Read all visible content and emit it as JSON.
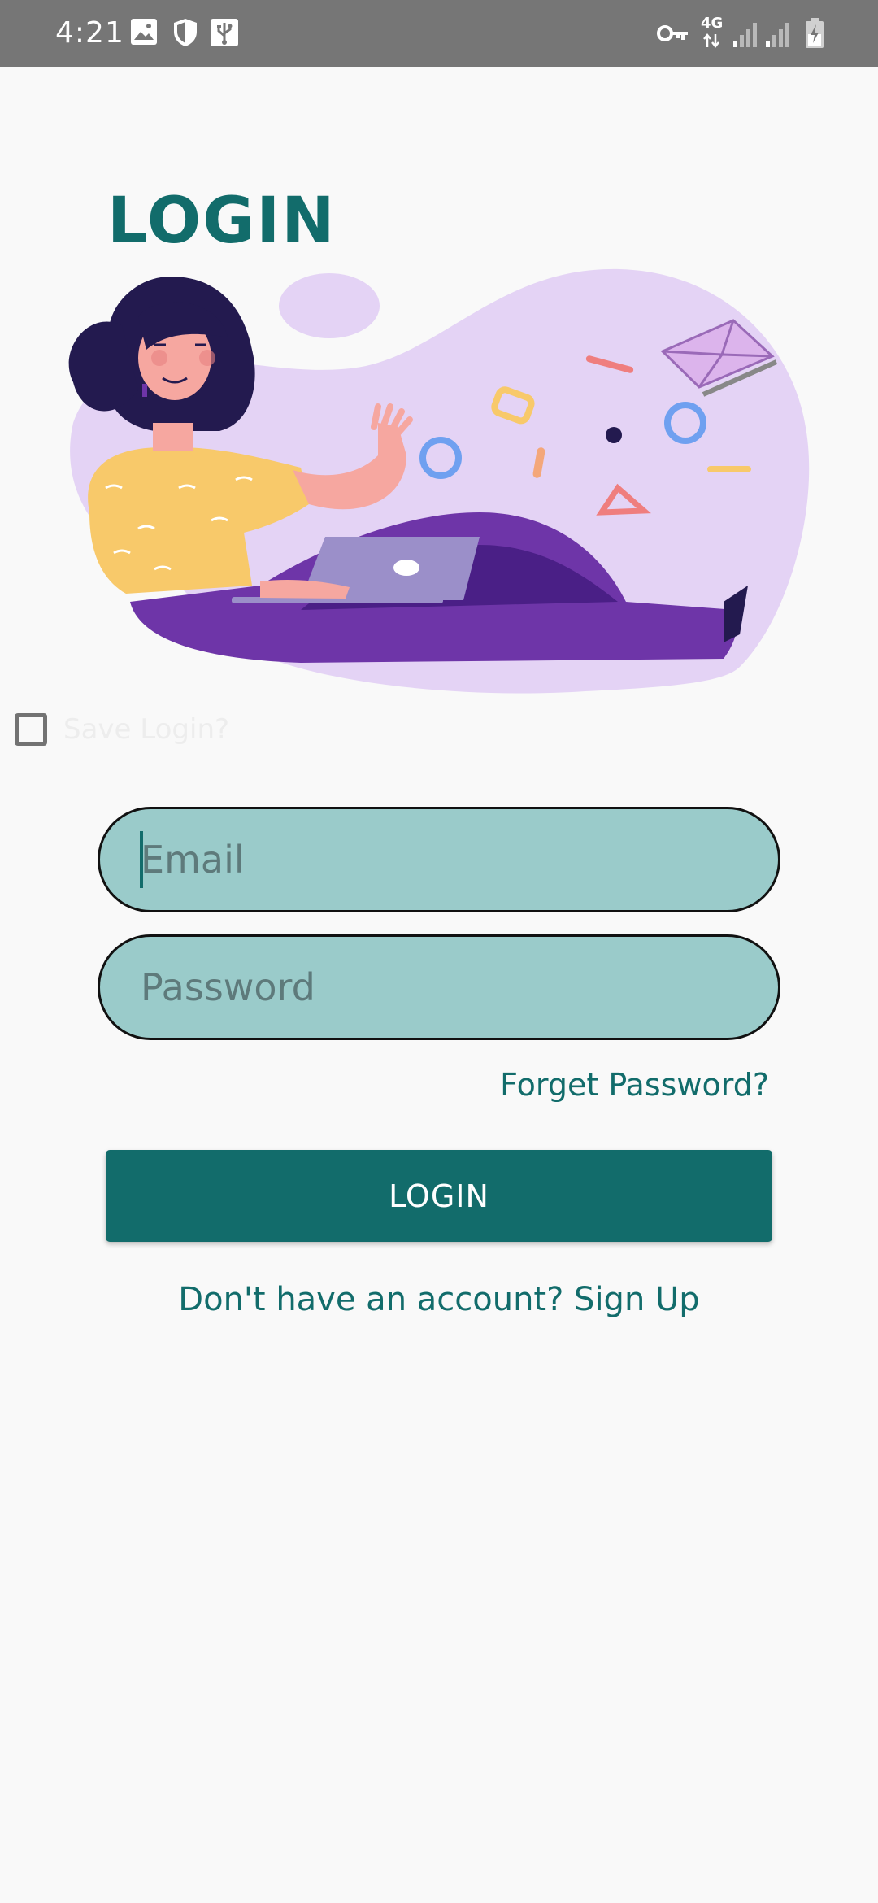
{
  "status_bar": {
    "time": "4:21",
    "network": "4G",
    "icons": [
      "image-icon",
      "shield-icon",
      "usb-icon",
      "vpn-key-icon",
      "4g-data-icon",
      "signal-icon",
      "signal-icon",
      "battery-charging-icon"
    ]
  },
  "title": "LOGIN",
  "illustration": {
    "icon": "woman-with-laptop-illustration",
    "colors": {
      "blob": "#e4d3f5",
      "pants": "#6e35a8",
      "shirt": "#f8c96a",
      "hair": "#231a4f",
      "laptop": "#9b8fc9"
    }
  },
  "save_login": {
    "label": "Save Login?",
    "checked": false
  },
  "form": {
    "email_placeholder": "Email",
    "email_value": "",
    "password_placeholder": "Password",
    "password_value": ""
  },
  "forget_password": "Forget Password?",
  "login_button": "LOGIN",
  "signup_text": "Don't have an account? Sign Up",
  "colors": {
    "accent": "#126c6b",
    "input_fill": "#9acbca",
    "background": "#f9f9f9",
    "status_bar": "#767676"
  }
}
